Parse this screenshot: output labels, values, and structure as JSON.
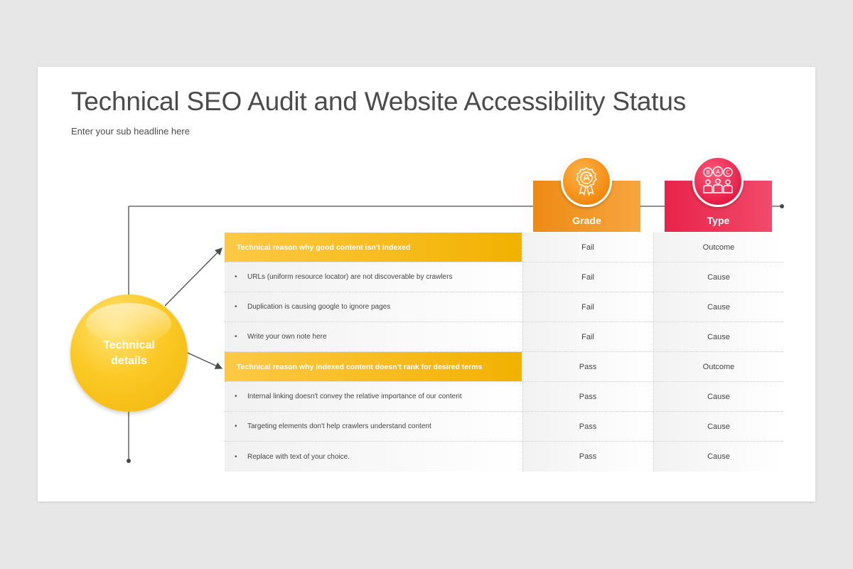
{
  "slide": {
    "title": "Technical SEO Audit and Website Accessibility Status",
    "subtitle": "Enter your sub headline here"
  },
  "circle": {
    "label": "Technical details"
  },
  "columns": [
    {
      "label": "Grade",
      "icon": "award-rosette-icon",
      "color": "#f28a10"
    },
    {
      "label": "Type",
      "icon": "people-abc-icon",
      "color": "#e51e48"
    }
  ],
  "rows": [
    {
      "kind": "header",
      "text": "Technical reason why good content isn't indexed",
      "grade": "Fail",
      "type": "Outcome"
    },
    {
      "kind": "detail",
      "bullet": "•",
      "text": "URLs (uniform resource locator) are not discoverable by crawlers",
      "grade": "Fail",
      "type": "Cause"
    },
    {
      "kind": "detail",
      "bullet": "•",
      "text": "Duplication is causing google to ignore pages",
      "grade": "Fail",
      "type": "Cause"
    },
    {
      "kind": "detail",
      "bullet": "•",
      "text": "Write your own note here",
      "grade": "Fail",
      "type": "Cause"
    },
    {
      "kind": "header",
      "text": "Technical reason why indexed content doesn't rank for desired terms",
      "grade": "Pass",
      "type": "Outcome"
    },
    {
      "kind": "detail",
      "bullet": "•",
      "text": "Internal linking doesn't convey the relative importance of our content",
      "grade": "Pass",
      "type": "Cause"
    },
    {
      "kind": "detail",
      "bullet": "•",
      "text": "Targeting elements don't help crawlers understand content",
      "grade": "Pass",
      "type": "Cause"
    },
    {
      "kind": "detail",
      "bullet": "•",
      "text": "Replace with text of your choice.",
      "grade": "Pass",
      "type": "Cause"
    }
  ],
  "colors": {
    "accent_yellow": "#f2b100",
    "accent_orange": "#f28a10",
    "accent_red": "#e51e48",
    "line": "#4a4a4a"
  }
}
